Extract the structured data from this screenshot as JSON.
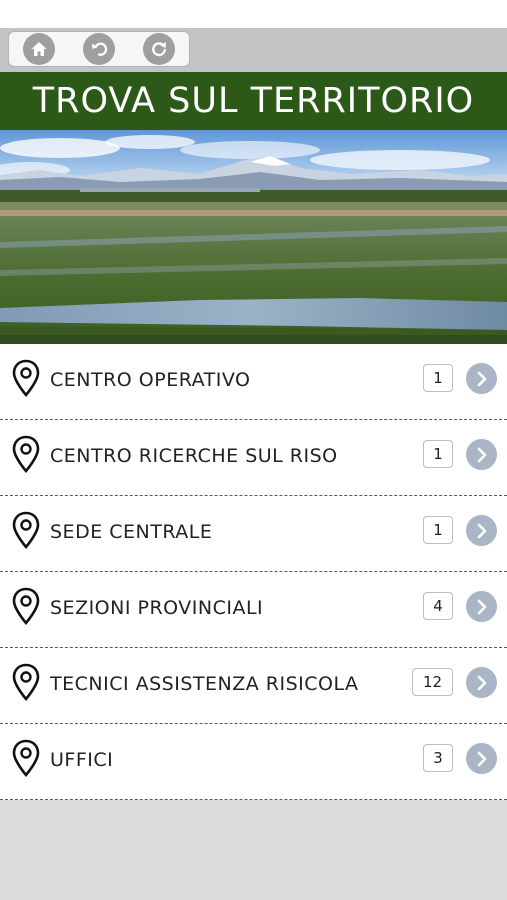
{
  "toolbar": {
    "buttons": [
      {
        "icon": "home-icon"
      },
      {
        "icon": "undo-icon"
      },
      {
        "icon": "refresh-icon"
      }
    ]
  },
  "header": {
    "title": "TROVA SUL TERRITORIO"
  },
  "colors": {
    "header_bg": "#2c5818",
    "chevron": "#aab5c6"
  },
  "list": {
    "items": [
      {
        "label": "CENTRO OPERATIVO",
        "count": "1"
      },
      {
        "label": "CENTRO RICERCHE SUL RISO",
        "count": "1"
      },
      {
        "label": "SEDE CENTRALE",
        "count": "1"
      },
      {
        "label": "SEZIONI PROVINCIALI",
        "count": "4"
      },
      {
        "label": "TECNICI ASSISTENZA RISICOLA",
        "count": "12"
      },
      {
        "label": "UFFICI",
        "count": "3"
      }
    ]
  }
}
